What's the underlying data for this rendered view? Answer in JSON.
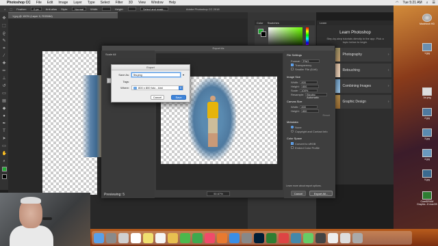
{
  "menubar": {
    "app": "Photoshop CC",
    "items": [
      "File",
      "Edit",
      "Image",
      "Layer",
      "Type",
      "Select",
      "Filter",
      "3D",
      "View",
      "Window",
      "Help"
    ],
    "clock": "Tue 5:21 AM"
  },
  "optbar": {
    "feather_label": "Feather:",
    "feather_value": "0 px",
    "antialias": "Anti-alias",
    "style_label": "Style:",
    "style_value": "Normal",
    "width_label": "Width:",
    "height_label": "Height:",
    "select_mask": "Select and mask...",
    "window_title": "Adobe Photoshop CC 2018"
  },
  "doc_tab": "1.jpg @ 100% (Layer 0, RGB/8#)",
  "color_panel": {
    "tab1": "Color",
    "tab2": "Swatches"
  },
  "learn_panel": {
    "tab": "Learn",
    "title": "Learn Photoshop",
    "subtitle": "Step-by-step tutorials directly in the app. Pick a topic below to begin.",
    "cards": [
      "Photography",
      "Retouching",
      "Combining Images",
      "Graphic Design"
    ]
  },
  "export_dialog": {
    "title": "Export As",
    "scale_all": "Scale All",
    "file_settings": "File Settings",
    "format_label": "Format:",
    "format_value": "PNG",
    "transparency": "Transparency",
    "smaller_file": "Smaller File (8-bit)",
    "image_size": "Image Size",
    "width_label": "Width:",
    "width_value": "800",
    "height_label": "Height:",
    "height_value": "800",
    "scale_label": "Scale:",
    "scale_value": "100%",
    "resample_label": "Resample:",
    "resample_value": "Bicubic Automatic",
    "canvas_size": "Canvas Size",
    "cwidth_value": "800",
    "cheight_value": "800",
    "reset": "Reset",
    "metadata": "Metadata",
    "meta_none": "None",
    "meta_copyright": "Copyright and Contact Info",
    "color_space": "Color Space",
    "convert_srgb": "Convert to sRGB",
    "embed_profile": "Embed Color Profile",
    "learn_more": "Learn more about export options.",
    "previewing": "Previewing: 5",
    "zoom": "50.67%",
    "cancel": "Cancel",
    "export_all": "Export All..."
  },
  "save_sheet": {
    "title": "Export",
    "save_as_label": "Save As:",
    "save_as_value": "5w.png",
    "tags_label": "Tags:",
    "where_label": "Where:",
    "where_value": "800 x 800 foto - kimi",
    "cancel": "Cancel",
    "save": "Save"
  },
  "desktop_icons": [
    "Macintosh HD",
    "1.jpg",
    "1w.png",
    "2.jpg",
    "3.jpg",
    "4.jpg",
    "5.jpg",
    "CorelDRAW Graphic...8 macOS"
  ],
  "colors": {
    "accent": "#3d83d9",
    "ps_dark": "#3c3c3c",
    "swatch_fg": "#22aa33"
  }
}
